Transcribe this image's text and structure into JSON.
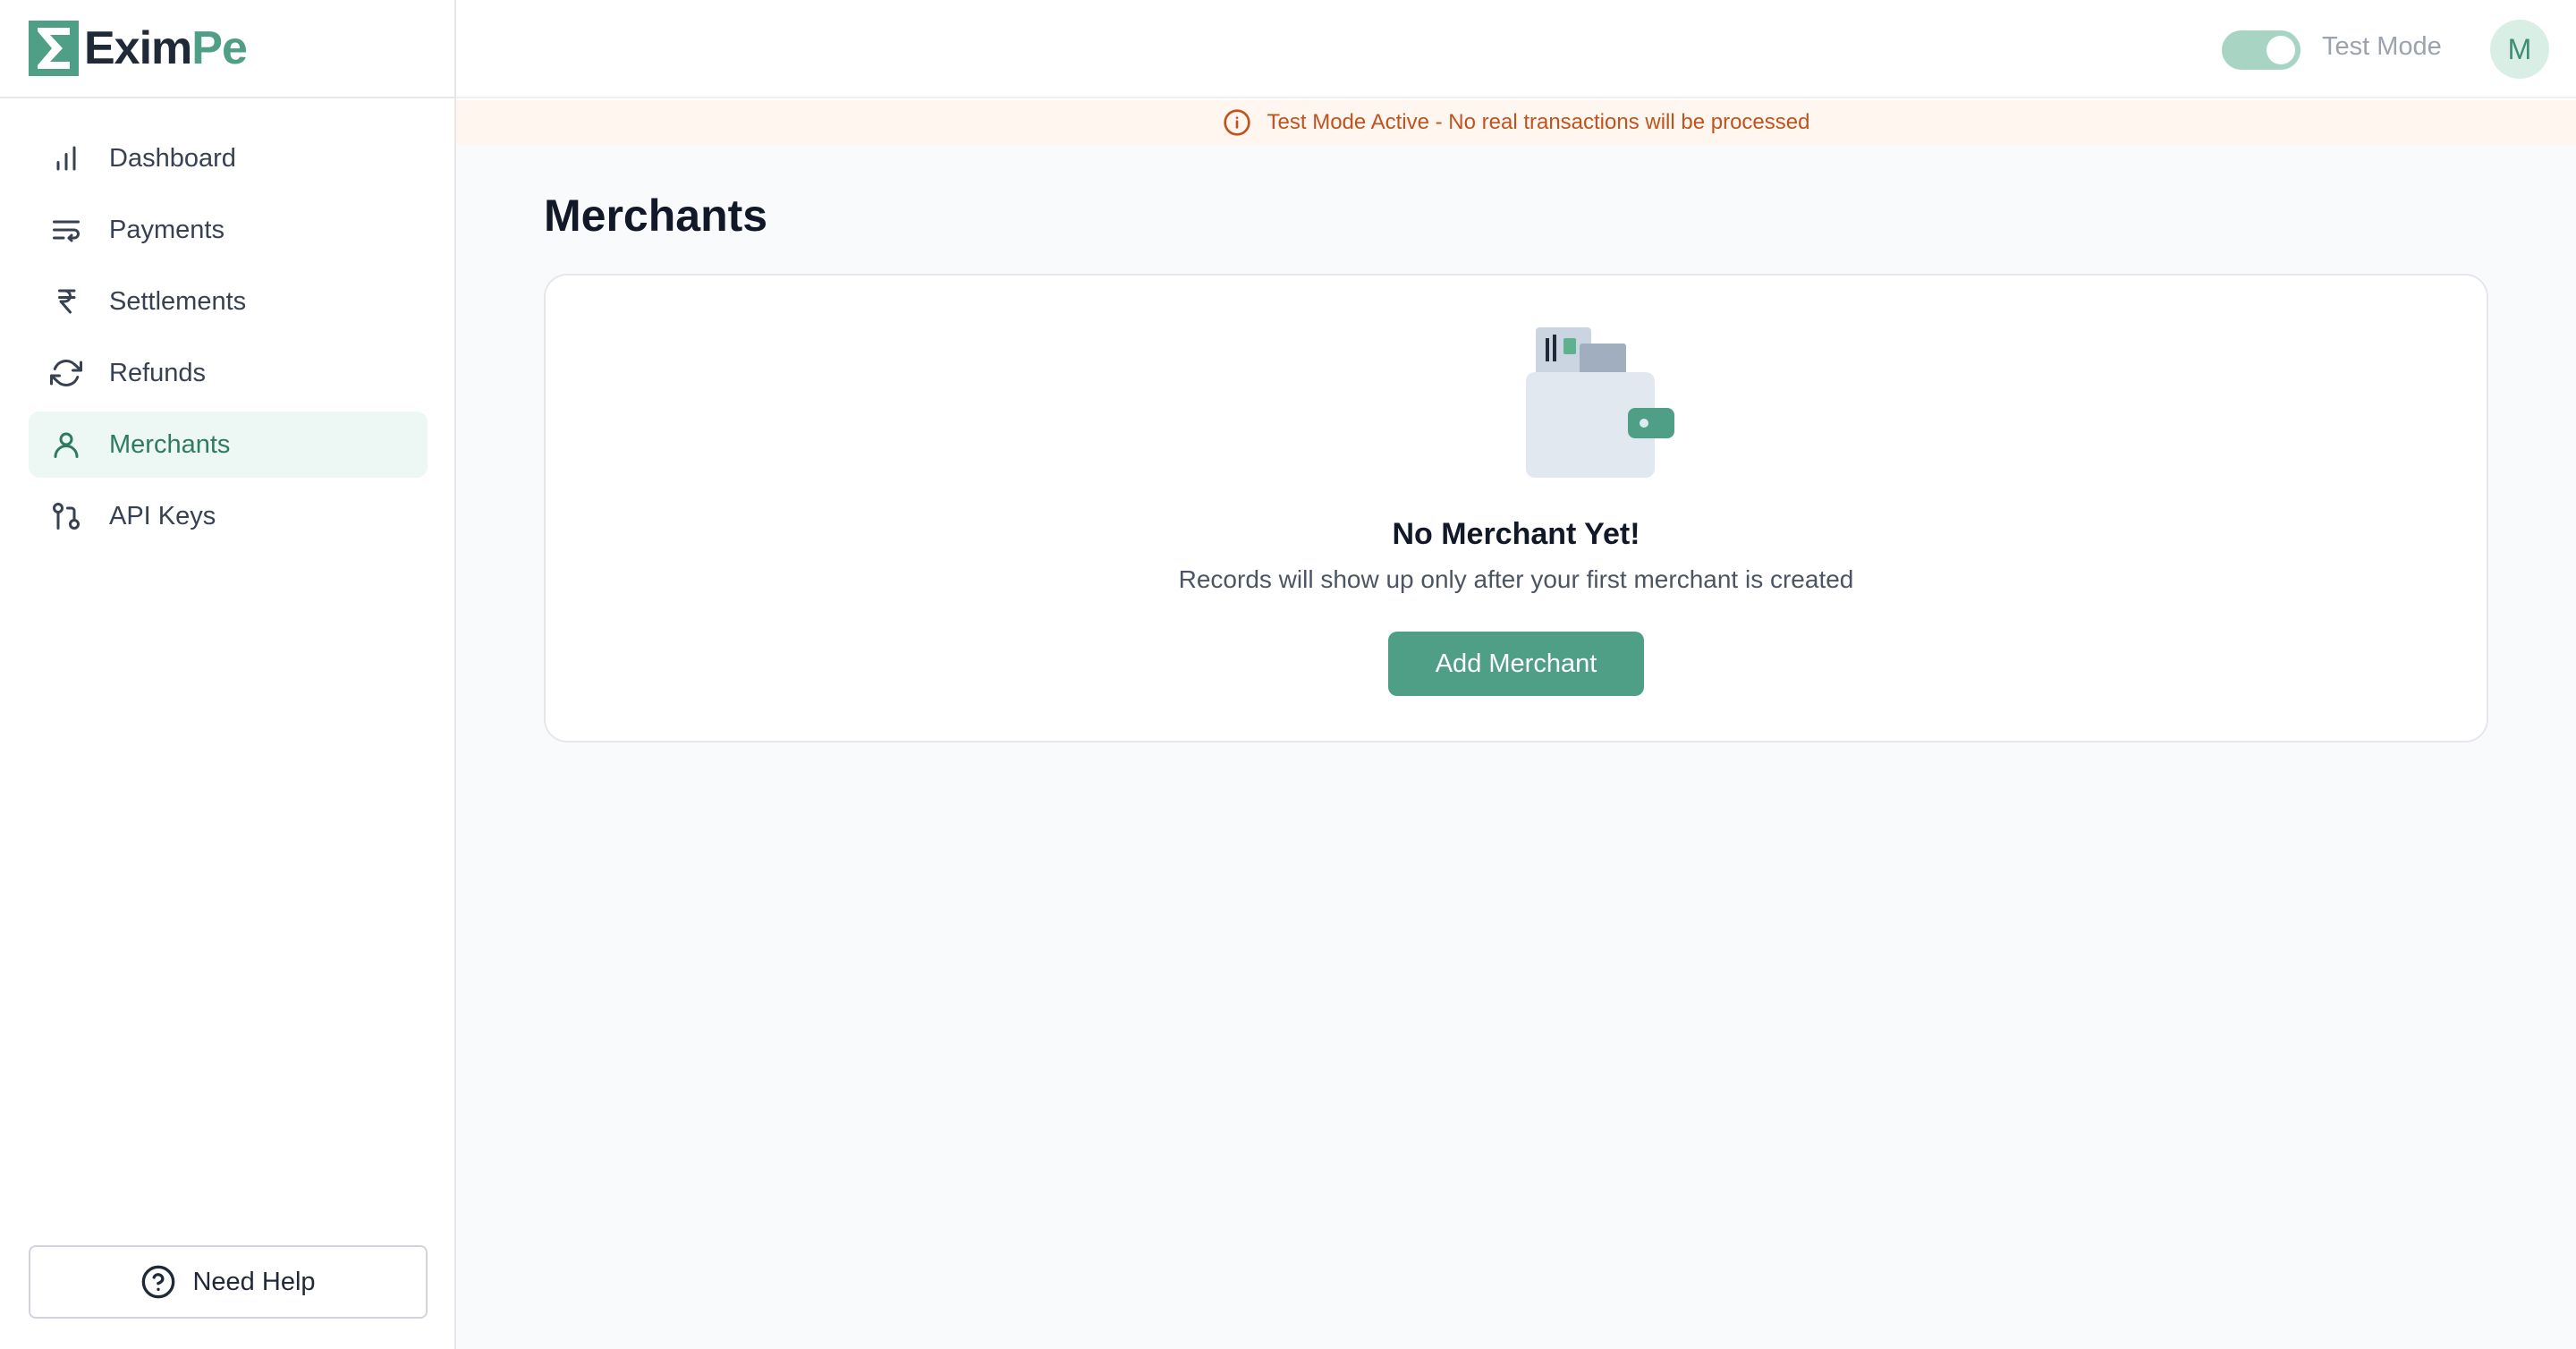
{
  "brand": {
    "name_part1": "Exim",
    "name_part2": "Pe",
    "accent_color": "#4f9f86",
    "logo_icon": "eximpe-logo-icon"
  },
  "sidebar": {
    "items": [
      {
        "label": "Dashboard",
        "icon": "bar-chart-icon",
        "active": false
      },
      {
        "label": "Payments",
        "icon": "list-wrap-icon",
        "active": false
      },
      {
        "label": "Settlements",
        "icon": "rupee-icon",
        "active": false
      },
      {
        "label": "Refunds",
        "icon": "refresh-icon",
        "active": false
      },
      {
        "label": "Merchants",
        "icon": "user-icon",
        "active": true
      },
      {
        "label": "API Keys",
        "icon": "git-pull-icon",
        "active": false
      }
    ],
    "help_label": "Need Help",
    "help_icon": "question-circle-icon"
  },
  "topbar": {
    "mode_label": "Test Mode",
    "test_mode_on": true,
    "avatar_initial": "M"
  },
  "banner": {
    "text": "Test Mode Active - No real transactions will be processed",
    "icon": "info-circle-icon",
    "color": "#c2521d"
  },
  "main": {
    "page_title": "Merchants",
    "empty_state": {
      "illustration": "wallet-illustration-icon",
      "title": "No Merchant Yet!",
      "subtitle": "Records will show up only after your first merchant is created",
      "button_label": "Add Merchant"
    }
  }
}
